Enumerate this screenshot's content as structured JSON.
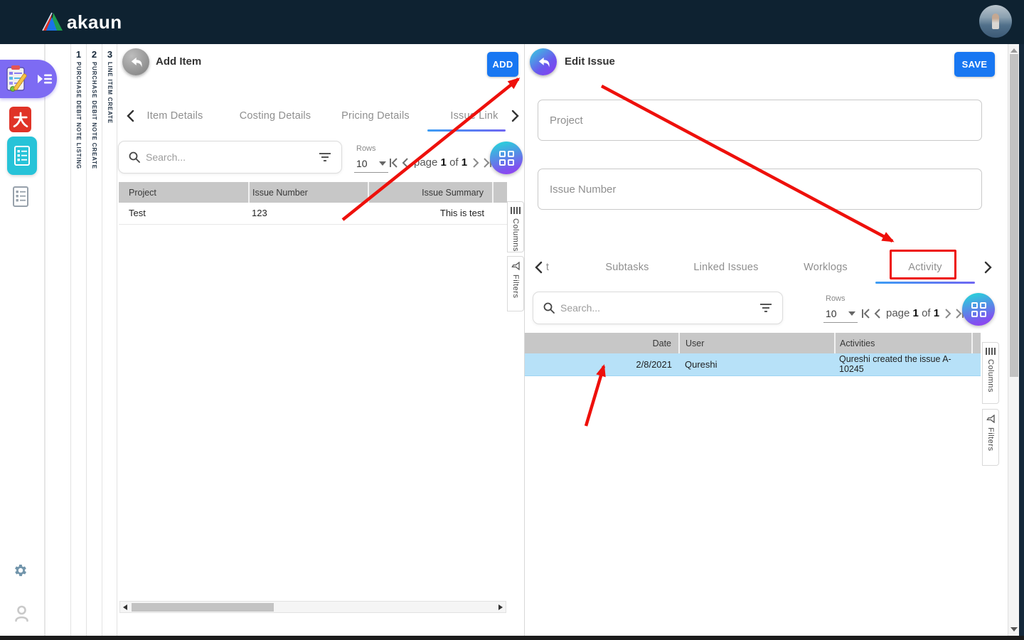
{
  "brand": "akaun",
  "workspace_tabs": [
    {
      "number": "1",
      "label": "PURCHASE DEBIT NOTE LISTING"
    },
    {
      "number": "2",
      "label": "PURCHASE DEBIT NOTE CREATE"
    },
    {
      "number": "3",
      "label": "LINE ITEM CREATE"
    }
  ],
  "left_panel": {
    "title": "Add Item",
    "add_button": "ADD",
    "tabs": {
      "t1": "Item Details",
      "t2": "Costing Details",
      "t3": "Pricing Details",
      "t4": "Issue Link"
    },
    "active_tab": "Issue Link",
    "search_placeholder": "Search...",
    "rows_label": "Rows",
    "rows_value": "10",
    "pager": {
      "page_word": "page",
      "page_num": "1",
      "of_word": "of",
      "page_total": "1"
    },
    "table": {
      "columns": [
        "Project",
        "Issue Number",
        "Issue Summary"
      ],
      "rows": [
        [
          "Test",
          "123",
          "This is test"
        ]
      ]
    },
    "side_tabs": {
      "columns": "Columns",
      "filters": "Filters"
    }
  },
  "right_panel": {
    "title": "Edit Issue",
    "save_button": "SAVE",
    "fields": {
      "project": "Project",
      "issue_number": "Issue Number"
    },
    "tabs": {
      "t0": "t",
      "t1": "Subtasks",
      "t2": "Linked Issues",
      "t3": "Worklogs",
      "t4": "Activity"
    },
    "active_tab": "Activity",
    "search_placeholder": "Search...",
    "rows_label": "Rows",
    "rows_value": "10",
    "pager": {
      "page_word": "page",
      "page_num": "1",
      "of_word": "of",
      "page_total": "1"
    },
    "table": {
      "columns": [
        "Date",
        "User",
        "Activities"
      ],
      "rows": [
        [
          "2/8/2021",
          "Qureshi",
          "Qureshi created the issue A-10245"
        ]
      ]
    },
    "side_tabs": {
      "columns": "Columns",
      "filters": "Filters"
    }
  },
  "colors": {
    "header_bg": "#0e2231",
    "primary_blue": "#1877f2",
    "accent_teal": "#2ec9dc",
    "accent_purple": "#8a3df0",
    "annotation_red": "#ee100b",
    "row_highlight": "#b7e1f8",
    "table_header_bg": "#c7c7c7"
  }
}
